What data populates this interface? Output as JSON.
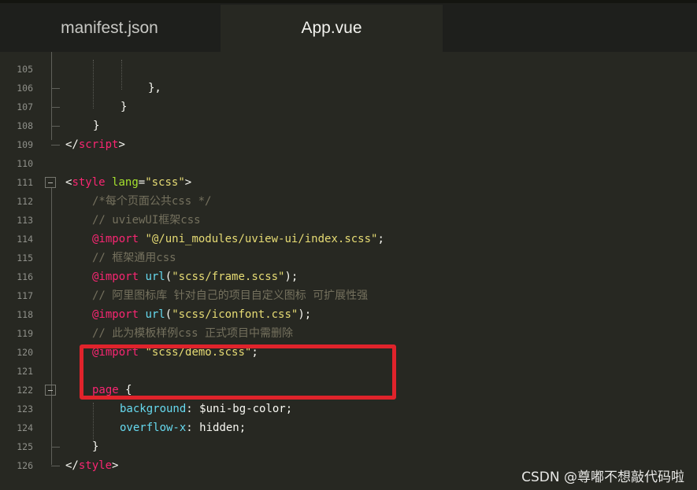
{
  "tabs": [
    {
      "label": "manifest.json",
      "active": false
    },
    {
      "label": "App.vue",
      "active": true
    }
  ],
  "lines": [
    {
      "num": "105",
      "tokens": []
    },
    {
      "num": "106",
      "tokens": [
        {
          "t": "},",
          "c": "txt"
        }
      ]
    },
    {
      "num": "107",
      "tokens": [
        {
          "t": "}",
          "c": "txt"
        }
      ]
    },
    {
      "num": "108",
      "tokens": [
        {
          "t": "}",
          "c": "txt"
        }
      ]
    },
    {
      "num": "109",
      "tokens": [
        {
          "t": "</",
          "c": "txt"
        },
        {
          "t": "script",
          "c": "tag"
        },
        {
          "t": ">",
          "c": "txt"
        }
      ]
    },
    {
      "num": "110",
      "tokens": []
    },
    {
      "num": "111",
      "tokens": [
        {
          "t": "<",
          "c": "txt"
        },
        {
          "t": "style",
          "c": "tag"
        },
        {
          "t": " ",
          "c": "txt"
        },
        {
          "t": "lang",
          "c": "attr"
        },
        {
          "t": "=",
          "c": "txt"
        },
        {
          "t": "\"scss\"",
          "c": "str"
        },
        {
          "t": ">",
          "c": "txt"
        }
      ]
    },
    {
      "num": "112",
      "tokens": [
        {
          "t": "/*每个页面公共css */",
          "c": "cmt"
        }
      ]
    },
    {
      "num": "113",
      "tokens": [
        {
          "t": "// uviewUI框架css",
          "c": "cmt"
        }
      ]
    },
    {
      "num": "114",
      "tokens": [
        {
          "t": "@import",
          "c": "at"
        },
        {
          "t": " ",
          "c": "txt"
        },
        {
          "t": "\"@/uni_modules/uview-ui/index.scss\"",
          "c": "str"
        },
        {
          "t": ";",
          "c": "txt"
        }
      ]
    },
    {
      "num": "115",
      "tokens": [
        {
          "t": "// 框架通用css",
          "c": "cmt"
        }
      ]
    },
    {
      "num": "116",
      "tokens": [
        {
          "t": "@import",
          "c": "at"
        },
        {
          "t": " ",
          "c": "txt"
        },
        {
          "t": "url",
          "c": "fn"
        },
        {
          "t": "(",
          "c": "txt"
        },
        {
          "t": "\"scss/frame.scss\"",
          "c": "str"
        },
        {
          "t": ");",
          "c": "txt"
        }
      ]
    },
    {
      "num": "117",
      "tokens": [
        {
          "t": "// 阿里图标库 针对自己的项目自定义图标 可扩展性强",
          "c": "cmt"
        }
      ]
    },
    {
      "num": "118",
      "tokens": [
        {
          "t": "@import",
          "c": "at"
        },
        {
          "t": " ",
          "c": "txt"
        },
        {
          "t": "url",
          "c": "fn"
        },
        {
          "t": "(",
          "c": "txt"
        },
        {
          "t": "\"scss/iconfont.css\"",
          "c": "str"
        },
        {
          "t": ");",
          "c": "txt"
        }
      ]
    },
    {
      "num": "119",
      "tokens": [
        {
          "t": "// 此为模板样例css 正式项目中需删除",
          "c": "cmt"
        }
      ]
    },
    {
      "num": "120",
      "tokens": [
        {
          "t": "@import",
          "c": "at"
        },
        {
          "t": " ",
          "c": "txt"
        },
        {
          "t": "\"scss/demo.scss\"",
          "c": "str"
        },
        {
          "t": ";",
          "c": "txt"
        }
      ]
    },
    {
      "num": "121",
      "tokens": []
    },
    {
      "num": "122",
      "tokens": [
        {
          "t": "page",
          "c": "tag"
        },
        {
          "t": " {",
          "c": "txt"
        }
      ]
    },
    {
      "num": "123",
      "tokens": [
        {
          "t": "background",
          "c": "prop"
        },
        {
          "t": ": $uni-bg-color;",
          "c": "txt"
        }
      ]
    },
    {
      "num": "124",
      "tokens": [
        {
          "t": "overflow-x",
          "c": "prop"
        },
        {
          "t": ": hidden;",
          "c": "txt"
        }
      ]
    },
    {
      "num": "125",
      "tokens": [
        {
          "t": "}",
          "c": "txt"
        }
      ]
    },
    {
      "num": "126",
      "tokens": [
        {
          "t": "</",
          "c": "txt"
        },
        {
          "t": "style",
          "c": "tag"
        },
        {
          "t": ">",
          "c": "txt"
        }
      ]
    }
  ],
  "watermark": "CSDN @尊嘟不想敲代码啦",
  "colors": {
    "background": "#272822",
    "tag": "#f92672",
    "attribute": "#a6e22e",
    "string": "#e6db74",
    "comment": "#75715e",
    "function": "#66d9ef",
    "highlight_box": "#e0232b"
  }
}
